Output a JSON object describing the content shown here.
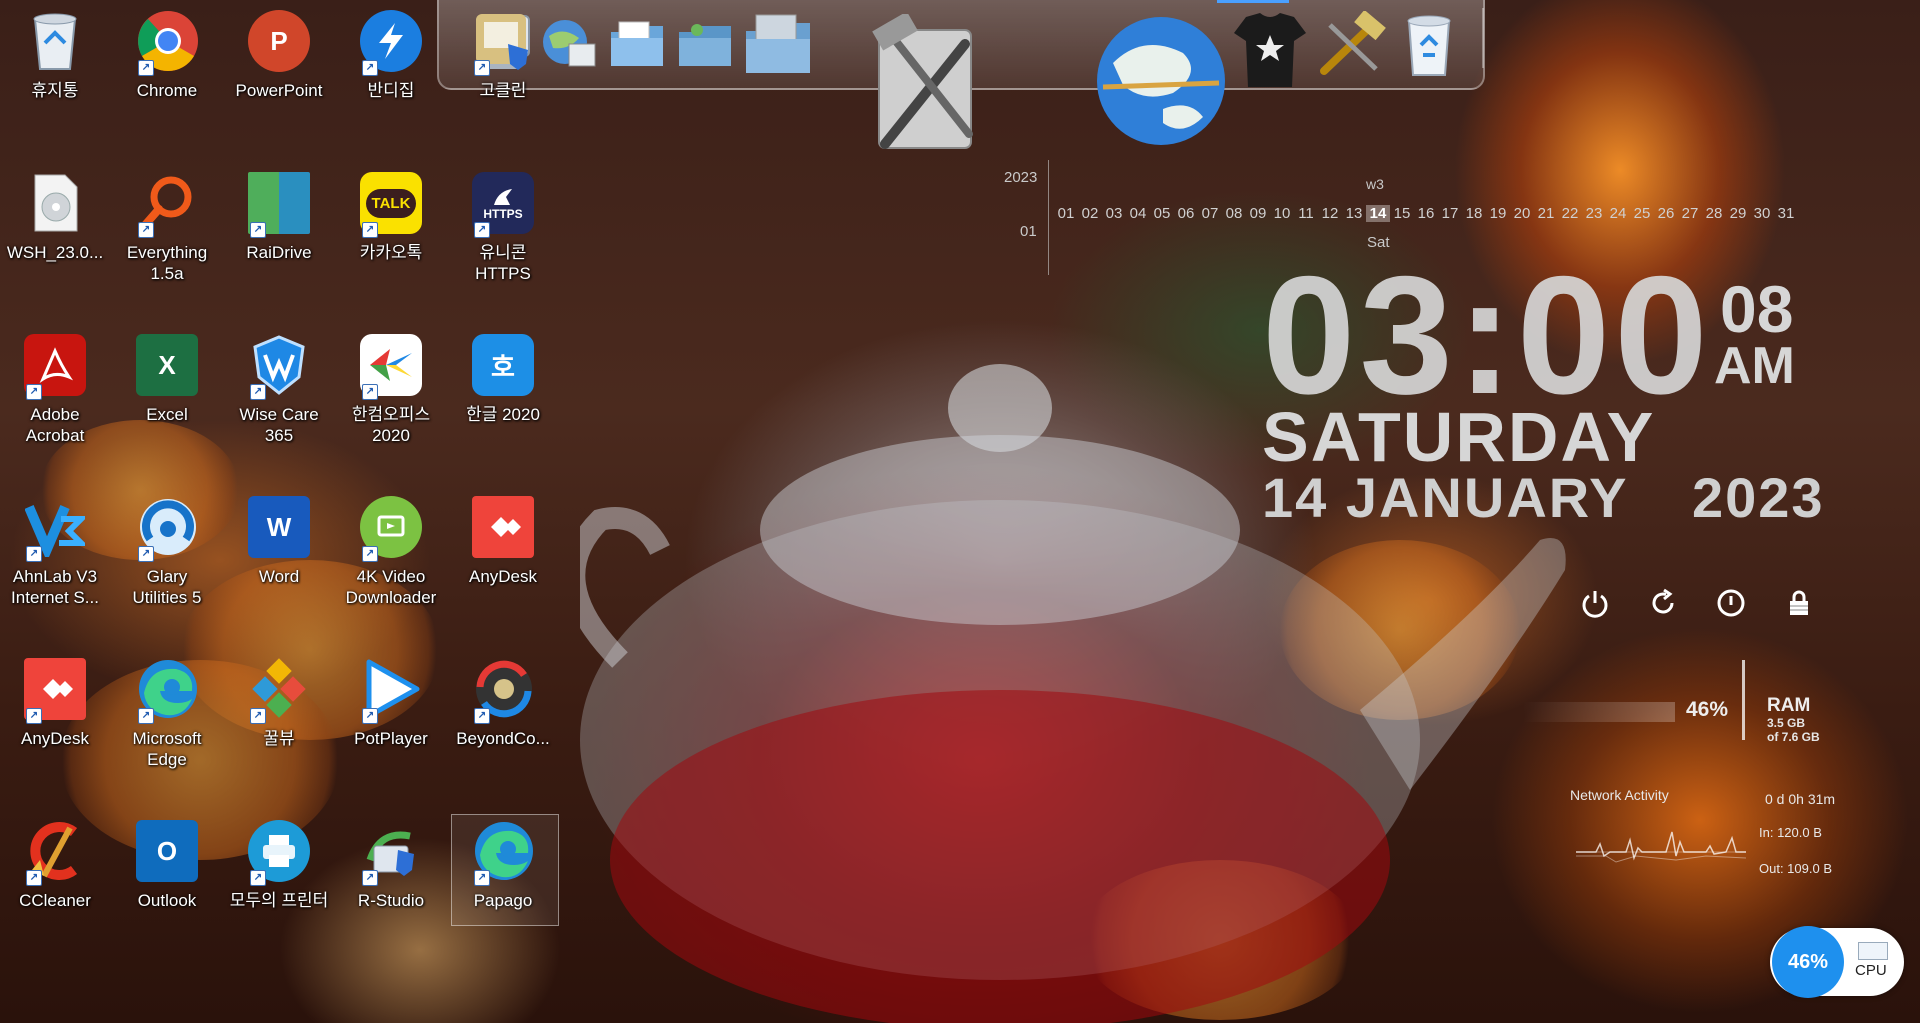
{
  "desktop": {
    "icons": [
      {
        "label": "휴지통"
      },
      {
        "label": "Chrome"
      },
      {
        "label": "PowerPoint"
      },
      {
        "label": "반디집"
      },
      {
        "label": "고클린"
      },
      {
        "label": "WSH_23.0..."
      },
      {
        "label": "Everything 1.5a"
      },
      {
        "label": "RaiDrive"
      },
      {
        "label": "카카오톡"
      },
      {
        "label": "유니콘 HTTPS"
      },
      {
        "label": "Adobe Acrobat"
      },
      {
        "label": "Excel"
      },
      {
        "label": "Wise Care 365"
      },
      {
        "label": "한컴오피스 2020"
      },
      {
        "label": "한글 2020"
      },
      {
        "label": "AhnLab V3 Internet S..."
      },
      {
        "label": "Glary Utilities 5"
      },
      {
        "label": "Word"
      },
      {
        "label": "4K Video Downloader"
      },
      {
        "label": "AnyDesk"
      },
      {
        "label": "AnyDesk"
      },
      {
        "label": "Microsoft Edge"
      },
      {
        "label": "꿀뷰"
      },
      {
        "label": "PotPlayer"
      },
      {
        "label": "BeyondCo..."
      },
      {
        "label": "CCleaner"
      },
      {
        "label": "Outlook"
      },
      {
        "label": "모두의 프린터"
      },
      {
        "label": "R-Studio"
      },
      {
        "label": "Papago"
      }
    ],
    "tile_glyphs": {
      "chrome": "",
      "powerpoint": "P",
      "excel": "X",
      "word": "W",
      "outlook": "O",
      "kakaotalk": "TALK",
      "https": "HTTPS",
      "hangul": "호"
    }
  },
  "calendar": {
    "year": "2023",
    "month": "01",
    "week": "w3",
    "dayname": "Sat",
    "days": [
      "01",
      "02",
      "03",
      "04",
      "05",
      "06",
      "07",
      "08",
      "09",
      "10",
      "11",
      "12",
      "13",
      "14",
      "15",
      "16",
      "17",
      "18",
      "19",
      "20",
      "21",
      "22",
      "23",
      "24",
      "25",
      "26",
      "27",
      "28",
      "29",
      "30",
      "31"
    ],
    "today": "14"
  },
  "clock": {
    "time": "03:00",
    "seconds": "08",
    "ampm": "AM",
    "weekday": "SATURDAY",
    "date": "14 JANUARY",
    "year": "2023"
  },
  "system": {
    "ram": {
      "percent": "46%",
      "label": "RAM",
      "used": "3.5 GB",
      "total": "of 7.6 GB",
      "fill": 0.46
    },
    "network": {
      "title": "Network Activity",
      "uptime": "0 d 0h 31m",
      "in": "In: 120.0 B",
      "out": "Out: 109.0 B"
    },
    "cpu": {
      "percent": "46%",
      "label": "CPU"
    }
  },
  "colors": {
    "clock_text": "#d6d6d6",
    "cpu_accent": "#1e90ee",
    "dock_highlight": "#4aa0ff"
  }
}
